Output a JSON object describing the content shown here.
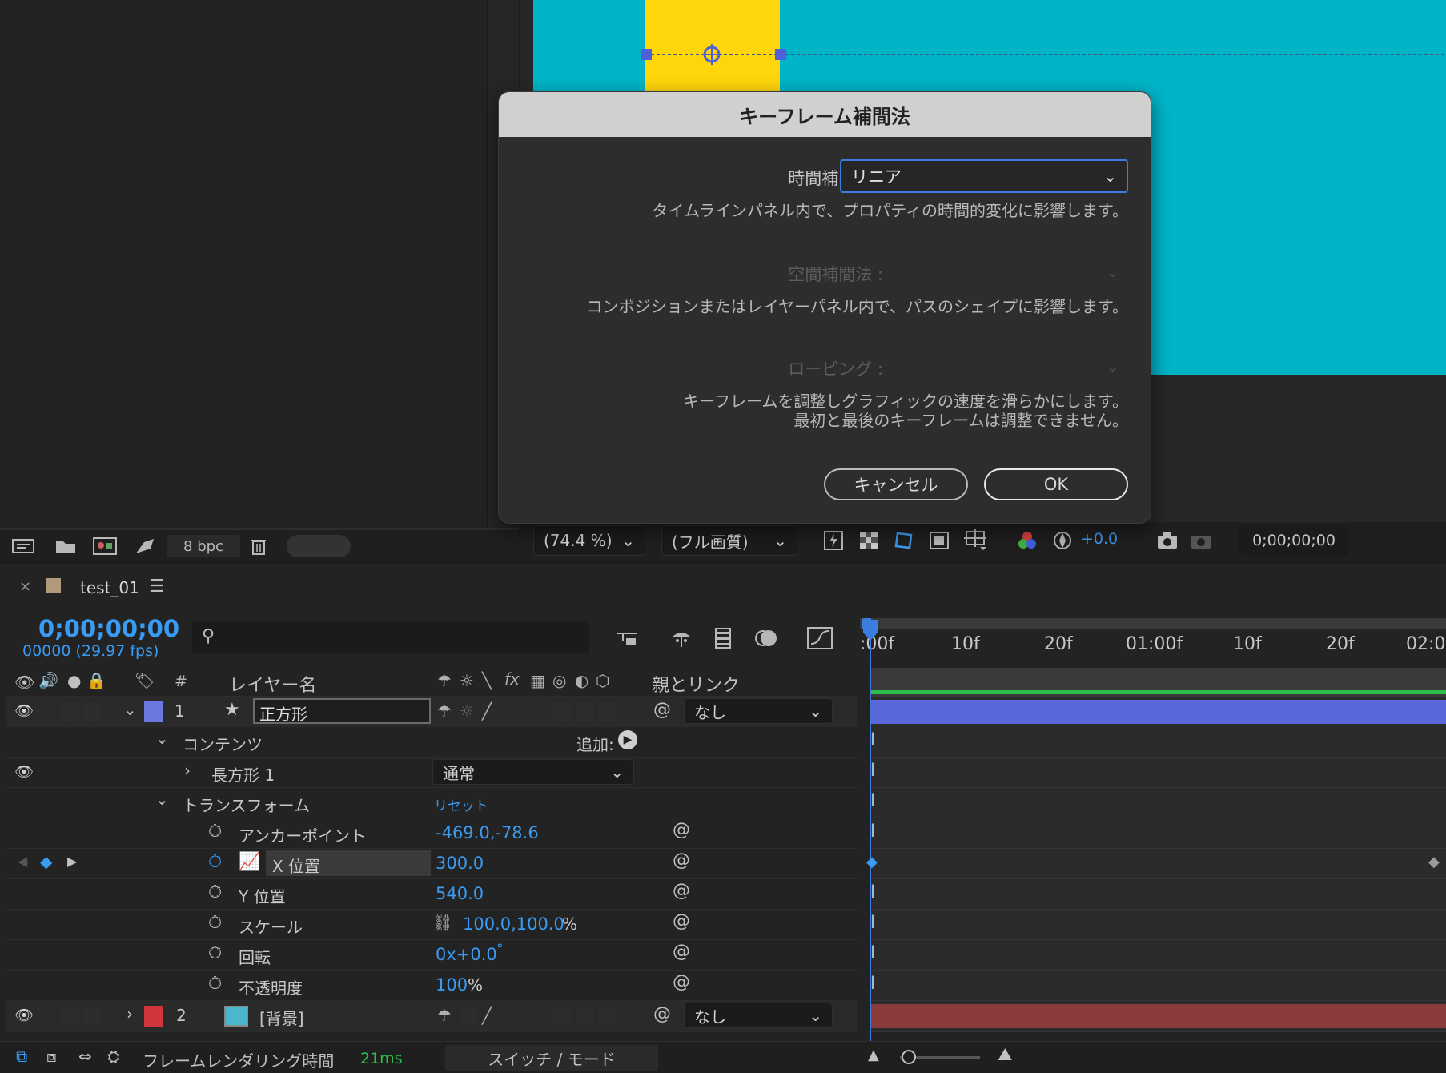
{
  "project_panel": {
    "bpc_label": "8 bpc"
  },
  "viewer": {
    "zoom": "(74.4 %)",
    "quality": "(フル画質)",
    "exposure": "+0.0",
    "timecode": "0;00;00;00",
    "colors": {
      "layer": "#ffd60c",
      "background": "#00b4c8"
    }
  },
  "dialog": {
    "title": "キーフレーム補間法",
    "temporal_label": "時間補間法 :",
    "temporal_value": "リニア",
    "temporal_desc": "タイムラインパネル内で、プロパティの時間的変化に影響します。",
    "spatial_label": "空間補間法 :",
    "spatial_desc": "コンポジションまたはレイヤーパネル内で、パスのシェイプに影響します。",
    "roving_label": "ロービング :",
    "roving_desc_1": "キーフレームを調整しグラフィックの速度を滑らかにします。",
    "roving_desc_2": "最初と最後のキーフレームは調整できません。",
    "cancel": "キャンセル",
    "ok": "OK"
  },
  "timeline": {
    "comp_name": "test_01",
    "timecode": "0;00;00;00",
    "frame_info": "00000 (29.97 fps)",
    "columns": {
      "hash": "#",
      "layer_name": "レイヤー名",
      "parent": "親とリンク"
    },
    "ruler": [
      ":00f",
      "10f",
      "20f",
      "01:00f",
      "10f",
      "20f",
      "02:0"
    ],
    "layers": [
      {
        "index": "1",
        "name": "正方形",
        "parent": "なし",
        "color": "#6c78e0",
        "bar_color": "#5868d8"
      },
      {
        "index": "2",
        "name": "[背景]",
        "parent": "なし",
        "color": "#d0353a",
        "bar_color": "#8a3a3a"
      }
    ],
    "contents": "コンテンツ",
    "add_label": "追加:",
    "rect_group": "長方形 1",
    "blend_mode": "通常",
    "transform": "トランスフォーム",
    "reset": "リセット",
    "props": [
      {
        "name": "アンカーポイント",
        "value": "-469.0,-78.6"
      },
      {
        "name": "X 位置",
        "value": "300.0"
      },
      {
        "name": "Y 位置",
        "value": "540.0"
      },
      {
        "name": "スケール",
        "value": "100.0,100.0",
        "unit": "%"
      },
      {
        "name": "回転",
        "value": "0x+0.0",
        "unit": "°"
      },
      {
        "name": "不透明度",
        "value": "100",
        "unit": "%"
      }
    ],
    "footer": {
      "render_label": "フレームレンダリング時間",
      "render_time": "21ms",
      "switch_mode": "スイッチ / モード"
    }
  }
}
